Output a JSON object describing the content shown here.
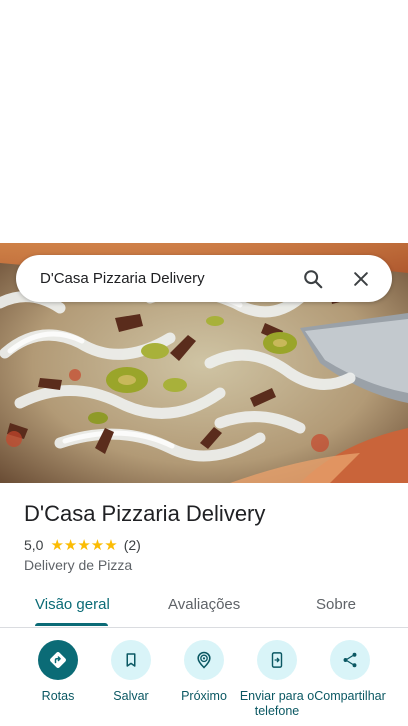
{
  "search": {
    "query": "D'Casa Pizzaria Delivery"
  },
  "place": {
    "title": "D'Casa Pizzaria Delivery",
    "rating": "5,0",
    "stars": "★★★★★",
    "review_count": "(2)",
    "category": "Delivery de Pizza"
  },
  "tabs": [
    {
      "label": "Visão geral",
      "active": true
    },
    {
      "label": "Avaliações",
      "active": false
    },
    {
      "label": "Sobre",
      "active": false
    }
  ],
  "actions": [
    {
      "label": "Rotas",
      "icon": "directions-icon"
    },
    {
      "label": "Salvar",
      "icon": "bookmark-icon"
    },
    {
      "label": "Próximo",
      "icon": "nearby-icon"
    },
    {
      "label": "Enviar para o telefone",
      "icon": "send-to-phone-icon"
    },
    {
      "label": "Compartilhar",
      "icon": "share-icon"
    }
  ],
  "colors": {
    "accent": "#0b6b76",
    "action_bg": "#d9f4f8",
    "star": "#fbbc04"
  }
}
